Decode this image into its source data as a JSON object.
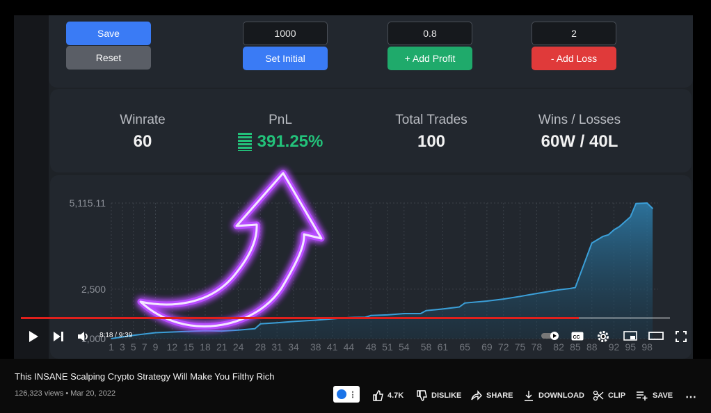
{
  "app": {
    "save_label": "Save",
    "reset_label": "Reset",
    "initial_value": "1000",
    "set_initial_label": "Set Initial",
    "profit_value": "0.8",
    "add_profit_label": "+ Add Profit",
    "loss_value": "2",
    "add_loss_label": "- Add Loss"
  },
  "stats": {
    "winrate_label": "Winrate",
    "winrate_value": "60",
    "pnl_label": "PnL",
    "pnl_value": "391.25%",
    "trades_label": "Total Trades",
    "trades_value": "100",
    "wl_label": "Wins / Losses",
    "wl_value": "60W / 40L"
  },
  "colors": {
    "save": "#3a7bf5",
    "reset": "#5a5e66",
    "set": "#3a7bf5",
    "profit": "#1faa6b",
    "loss": "#e03a3a",
    "pnl": "#23c27a",
    "line": "#3b9fd8",
    "arrow": "#b84dff",
    "progress": "#e0201c"
  },
  "chart_data": {
    "type": "area",
    "y_ticks": [
      "5,115.11",
      "2,500",
      "1,000"
    ],
    "x_ticks": [
      "1",
      "3",
      "5",
      "7",
      "9",
      "12",
      "15",
      "18",
      "21",
      "24",
      "28",
      "31",
      "34",
      "38",
      "41",
      "44",
      "48",
      "51",
      "54",
      "58",
      "61",
      "65",
      "69",
      "72",
      "75",
      "78",
      "82",
      "85",
      "88",
      "92",
      "95",
      "98"
    ],
    "ylim": [
      1000,
      5115.11
    ],
    "x": [
      1,
      5,
      9,
      12,
      15,
      18,
      21,
      24,
      27,
      28,
      31,
      34,
      38,
      41,
      44,
      47,
      48,
      51,
      54,
      57,
      58,
      61,
      64,
      65,
      69,
      72,
      75,
      78,
      82,
      84,
      85,
      88,
      90,
      91,
      92,
      93,
      95,
      96,
      98,
      99
    ],
    "values": [
      1000,
      1100,
      1180,
      1200,
      1220,
      1240,
      1230,
      1260,
      1300,
      1450,
      1480,
      1520,
      1560,
      1600,
      1640,
      1650,
      1700,
      1720,
      1760,
      1760,
      1850,
      1900,
      1960,
      2080,
      2140,
      2200,
      2280,
      2370,
      2480,
      2520,
      2550,
      3900,
      4100,
      4150,
      4300,
      4400,
      4700,
      5100,
      5115,
      4950
    ],
    "grid": true
  },
  "player": {
    "time": "8:18 / 9:39",
    "progress": 0.86
  },
  "video": {
    "title": "This INSANE Scalping Crypto Strategy Will Make You Filthy Rich",
    "meta": "126,323 views • Mar 20, 2022",
    "likes": "4.7K",
    "dislike": "DISLIKE",
    "share": "SHARE",
    "download": "DOWNLOAD",
    "clip": "CLIP",
    "save": "SAVE"
  },
  "icons": [
    "play-icon",
    "next-icon",
    "volume-icon",
    "autoplay-toggle-icon",
    "cc-icon",
    "gear-icon",
    "miniplayer-icon",
    "theater-icon",
    "fullscreen-icon",
    "like-icon",
    "dislike-icon",
    "share-icon",
    "download-icon",
    "clip-icon",
    "save-playlist-icon",
    "more-icon",
    "pnl-bars-icon",
    "arrow-overlay"
  ]
}
